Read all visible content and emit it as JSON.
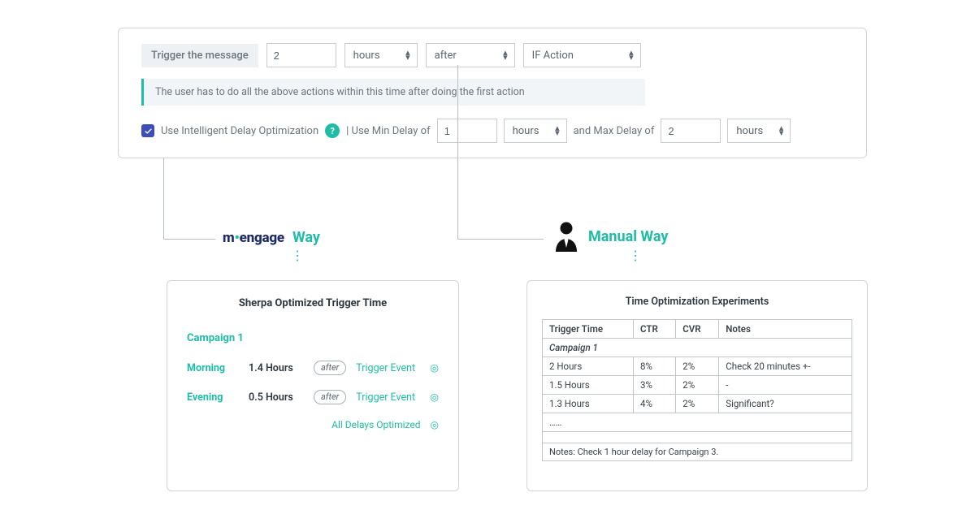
{
  "trigger_row": {
    "label": "Trigger the message",
    "value": "2",
    "unit": "hours",
    "relation": "after",
    "condition": "IF Action"
  },
  "info_text": "The user has to do all the above actions within this time after doing the first action",
  "ido": {
    "checkbox_checked": true,
    "label": "Use Intelligent Delay Optimization",
    "help_icon": "?",
    "min_label": "| Use Min Delay of",
    "min_value": "1",
    "min_unit": "hours",
    "mid_label": "and Max Delay of",
    "max_value": "2",
    "max_unit": "hours"
  },
  "headers": {
    "moengage_brand_prefix": "m",
    "moengage_brand_rest": "engage",
    "moengage_way": "Way",
    "manual_way": "Manual Way"
  },
  "left_card": {
    "title": "Sherpa Optimized Trigger Time",
    "campaign": "Campaign 1",
    "rows": [
      {
        "slot": "Morning",
        "hours": "1.4 Hours",
        "pill": "after",
        "event": "Trigger Event"
      },
      {
        "slot": "Evening",
        "hours": "0.5 Hours",
        "pill": "after",
        "event": "Trigger Event"
      }
    ],
    "footer": "All Delays Optimized"
  },
  "right_card": {
    "title": "Time Optimization Experiments",
    "caption": "Campaign 1",
    "columns": [
      "Trigger Time",
      "CTR",
      "CVR",
      "Notes"
    ],
    "rows": [
      {
        "c0": "2 Hours",
        "c1": "8%",
        "c2": "2%",
        "c3": "Check 20 minutes +-"
      },
      {
        "c0": "1.5 Hours",
        "c1": "3%",
        "c2": "2%",
        "c3": "-"
      },
      {
        "c0": "1.3 Hours",
        "c1": "4%",
        "c2": "2%",
        "c3": "Significant?"
      }
    ],
    "ellipsis": "……",
    "footer_note": "Notes: Check 1 hour delay for Campaign 3."
  }
}
